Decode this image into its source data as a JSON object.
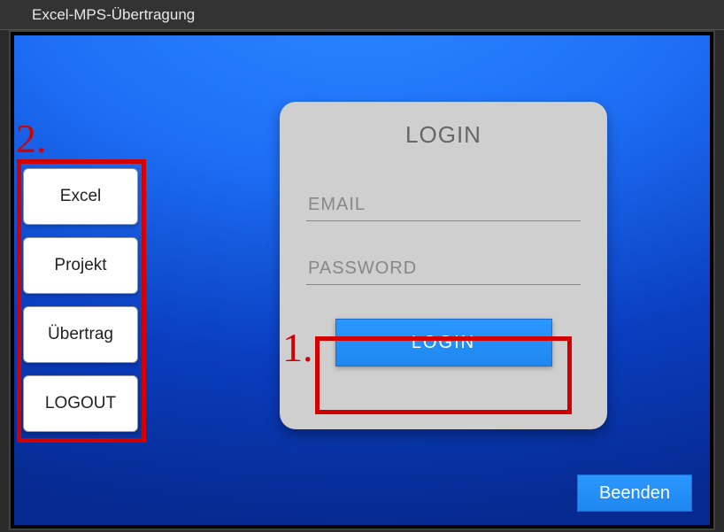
{
  "window": {
    "title": "Excel-MPS-Übertragung"
  },
  "sidebar": {
    "items": [
      {
        "label": "Excel"
      },
      {
        "label": "Projekt"
      },
      {
        "label": "Übertrag"
      },
      {
        "label": "LOGOUT"
      }
    ]
  },
  "login": {
    "title": "LOGIN",
    "email_placeholder": "EMAIL",
    "password_placeholder": "PASSWORD",
    "button_label": "LOGIN"
  },
  "footer": {
    "close_label": "Beenden"
  },
  "annotations": {
    "num1": "1.",
    "num2": "2."
  }
}
